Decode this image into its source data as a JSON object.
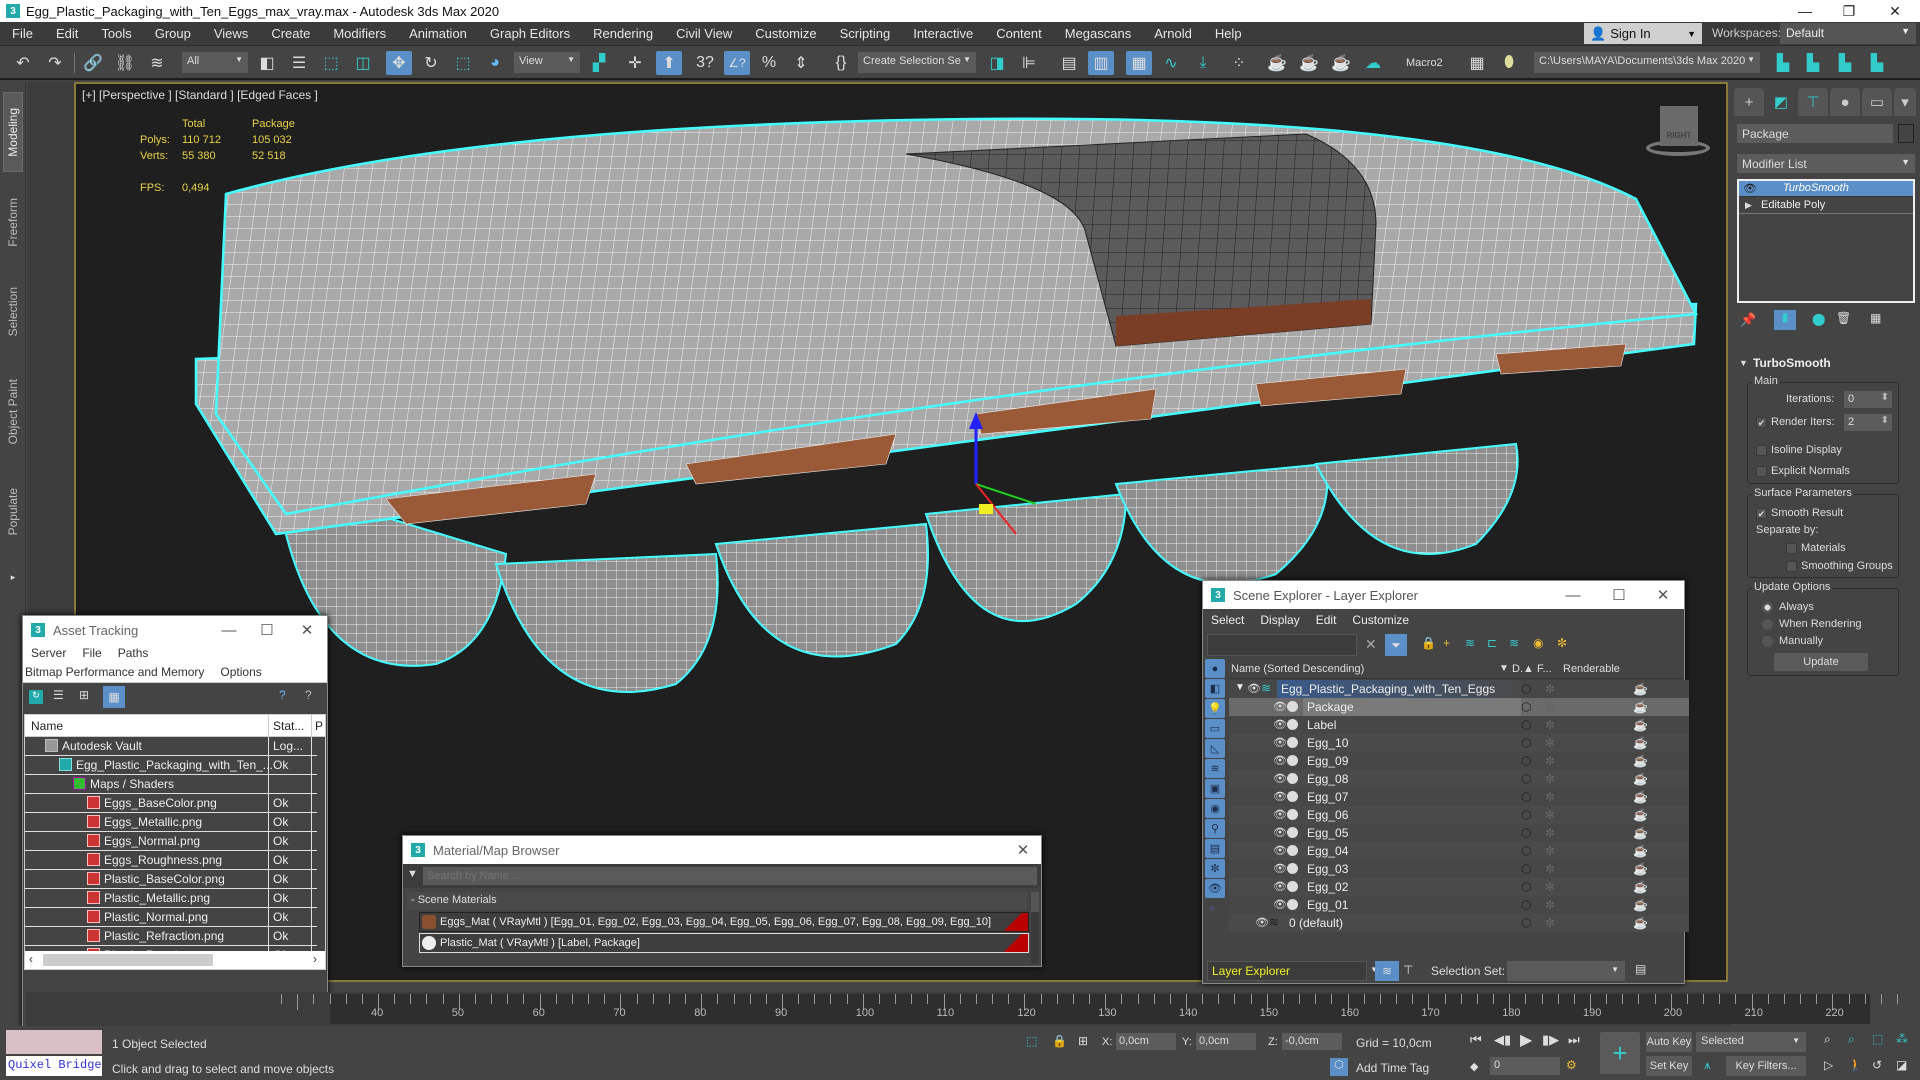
{
  "window": {
    "title": "Egg_Plastic_Packaging_with_Ten_Eggs_max_vray.max - Autodesk 3ds Max 2020",
    "app_icon": "3",
    "minimize": "—",
    "maximize": "❐",
    "close": "✕"
  },
  "menubar": {
    "items": [
      "File",
      "Edit",
      "Tools",
      "Group",
      "Views",
      "Create",
      "Modifiers",
      "Animation",
      "Graph Editors",
      "Rendering",
      "Civil View",
      "Customize",
      "Scripting",
      "Interactive",
      "Content",
      "Megascans",
      "Arnold",
      "Help"
    ],
    "sign_in": "Sign In",
    "workspaces_label": "Workspaces:",
    "workspace_value": "Default"
  },
  "toolbar": {
    "selection_filter": "All",
    "reference_coord": "View",
    "selection_set": "Create Selection Se",
    "macro_label": "Macro2",
    "project_path": "C:\\Users\\MAYA\\Documents\\3ds Max 2020",
    "icons": [
      "undo-icon",
      "redo-icon",
      "link-icon",
      "unlink-icon",
      "bind-spacewarp-icon",
      "select-object-icon",
      "select-by-name-icon",
      "rect-selection-icon",
      "window-crossing-icon",
      "select-move-icon",
      "select-rotate-icon",
      "select-scale-icon",
      "select-place-icon",
      "use-pivot-icon",
      "manipulate-icon",
      "keyboard-shortcut-icon",
      "snaps-toggle-icon",
      "angle-snap-icon",
      "percent-snap-icon",
      "spinner-snap-icon",
      "edit-named-sel-icon",
      "mirror-icon",
      "align-icon",
      "scene-explorer-icon",
      "layer-explorer-icon",
      "ribbon-toggle-icon",
      "curve-editor-icon",
      "schematic-view-icon",
      "material-editor-icon",
      "render-setup-icon",
      "rendered-frame-icon",
      "render-production-icon",
      "render-cloud-icon"
    ]
  },
  "ribbon_tabs": [
    "Modeling",
    "Freeform",
    "Selection",
    "Object Paint",
    "Populate"
  ],
  "viewport": {
    "label": "[+] [Perspective ] [Standard ] [Edged Faces ]",
    "stats": {
      "col_total": "Total",
      "col_package": "Package",
      "polys_label": "Polys:",
      "polys_total": "110 712",
      "polys_package": "105 032",
      "verts_label": "Verts:",
      "verts_total": "55 380",
      "verts_package": "52 518",
      "fps_label": "FPS:",
      "fps_value": "0,494"
    },
    "viewcube_label": "RIGHT"
  },
  "command_panel": {
    "tabs": [
      "create-icon",
      "modify-icon",
      "hierarchy-icon",
      "motion-icon",
      "display-icon",
      "utilities-icon"
    ],
    "object_name": "Package",
    "modifier_list": "Modifier List",
    "stack": [
      {
        "label": "TurboSmooth",
        "selected": true
      },
      {
        "label": "Editable Poly",
        "selected": false
      }
    ],
    "rollout_title": "TurboSmooth",
    "main_group": "Main",
    "iterations_label": "Iterations:",
    "iterations_value": "0",
    "render_iters_label": "Render Iters:",
    "render_iters_value": "2",
    "render_iters_checked": true,
    "isoline_label": "Isoline Display",
    "isoline_checked": false,
    "explicit_normals_label": "Explicit Normals",
    "explicit_normals_checked": false,
    "surface_group": "Surface Parameters",
    "smooth_result_label": "Smooth Result",
    "smooth_result_checked": true,
    "separate_by_label": "Separate by:",
    "materials_label": "Materials",
    "smoothing_groups_label": "Smoothing Groups",
    "update_group": "Update Options",
    "update_always": "Always",
    "update_when_rendering": "When Rendering",
    "update_manually": "Manually",
    "update_selected": "Always",
    "update_button": "Update"
  },
  "asset_tracking": {
    "title": "Asset Tracking",
    "menu_row1": [
      "Server",
      "File",
      "Paths"
    ],
    "menu_row2": [
      "Bitmap Performance and Memory",
      "Options"
    ],
    "col_name": "Name",
    "col_status": "Stat...",
    "col_path": "P",
    "rows": [
      {
        "name": "Autodesk Vault",
        "status": "Log...",
        "indent": 1,
        "icon": "vault-icon"
      },
      {
        "name": "Egg_Plastic_Packaging_with_Ten_...",
        "status": "Ok",
        "indent": 2,
        "icon": "max-file-icon"
      },
      {
        "name": "Maps / Shaders",
        "status": "",
        "indent": 3,
        "icon": "maps-icon"
      },
      {
        "name": "Eggs_BaseColor.png",
        "status": "Ok",
        "indent": 4,
        "icon": "png-icon"
      },
      {
        "name": "Eggs_Metallic.png",
        "status": "Ok",
        "indent": 4,
        "icon": "png-icon"
      },
      {
        "name": "Eggs_Normal.png",
        "status": "Ok",
        "indent": 4,
        "icon": "png-icon"
      },
      {
        "name": "Eggs_Roughness.png",
        "status": "Ok",
        "indent": 4,
        "icon": "png-icon"
      },
      {
        "name": "Plastic_BaseColor.png",
        "status": "Ok",
        "indent": 4,
        "icon": "png-icon"
      },
      {
        "name": "Plastic_Metallic.png",
        "status": "Ok",
        "indent": 4,
        "icon": "png-icon"
      },
      {
        "name": "Plastic_Normal.png",
        "status": "Ok",
        "indent": 4,
        "icon": "png-icon"
      },
      {
        "name": "Plastic_Refraction.png",
        "status": "Ok",
        "indent": 4,
        "icon": "png-icon"
      },
      {
        "name": "Plastic_Roughness.png",
        "status": "Ok",
        "indent": 4,
        "icon": "png-icon"
      }
    ]
  },
  "material_browser": {
    "title": "Material/Map Browser",
    "search_placeholder": "Search by Name ...",
    "section": "- Scene Materials",
    "materials": [
      {
        "label": "Eggs_Mat  ( VRayMtl ) [Egg_01, Egg_02, Egg_03, Egg_04, Egg_05, Egg_06, Egg_07, Egg_08, Egg_09, Egg_10]",
        "swatch": "#8a5030"
      },
      {
        "label": "Plastic_Mat  ( VRayMtl ) [Label, Package]",
        "swatch": "#eeeeee"
      }
    ]
  },
  "scene_explorer": {
    "title": "Scene Explorer - Layer Explorer",
    "menu": [
      "Select",
      "Display",
      "Edit",
      "Customize"
    ],
    "col_name": "Name (Sorted Descending)",
    "col_display": "D.▲",
    "col_freeze": "F...",
    "col_renderable": "Renderable",
    "layer": "Egg_Plastic_Packaging_with_Ten_Eggs",
    "objects": [
      "Package",
      "Label",
      "Egg_10",
      "Egg_09",
      "Egg_08",
      "Egg_07",
      "Egg_06",
      "Egg_05",
      "Egg_04",
      "Egg_03",
      "Egg_02",
      "Egg_01"
    ],
    "selected_object": "Package",
    "default_layer": "0 (default)",
    "explorer_select": "Layer Explorer",
    "selection_set_label": "Selection Set:",
    "selection_set_value": ""
  },
  "timeline": {
    "ticks": [
      "40",
      "50",
      "60",
      "70",
      "80",
      "90",
      "100",
      "110",
      "120",
      "130",
      "140",
      "150",
      "160",
      "170",
      "180",
      "190",
      "200",
      "210",
      "220"
    ]
  },
  "status": {
    "selected": "1 Object Selected",
    "prompt": "Click and drag to select and move objects",
    "quixel": "Quixel Bridge",
    "x_label": "X:",
    "x_value": "0,0cm",
    "y_label": "Y:",
    "y_value": "0,0cm",
    "z_label": "Z:",
    "z_value": "-0,0cm",
    "grid": "Grid = 10,0cm",
    "add_time_tag": "Add Time Tag",
    "auto_key": "Auto Key",
    "set_key": "Set Key",
    "key_mode": "Selected",
    "key_filters": "Key Filters...",
    "frame": "0"
  }
}
